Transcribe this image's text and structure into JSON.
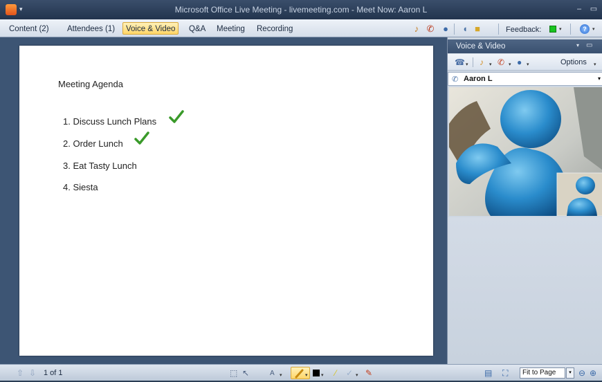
{
  "window": {
    "title": "Microsoft Office Live Meeting - livemeeting.com - Meet Now: Aaron L",
    "minimize_glyph": "–",
    "maximize_glyph": "▭"
  },
  "menu": {
    "items": [
      {
        "label": "Content (2)"
      },
      {
        "label": "Attendees (1)"
      },
      {
        "label": "Voice & Video",
        "active": true
      },
      {
        "label": "Q&A"
      },
      {
        "label": "Meeting"
      },
      {
        "label": "Recording"
      }
    ],
    "feedback_label": "Feedback:",
    "feedback_color": "#19c421"
  },
  "slide": {
    "title": "Meeting Agenda",
    "items": [
      {
        "text": "1. Discuss Lunch Plans",
        "checked": true
      },
      {
        "text": "2. Order Lunch",
        "checked": true
      },
      {
        "text": "3. Eat Tasty Lunch",
        "checked": false
      },
      {
        "text": "4. Siesta",
        "checked": false
      }
    ],
    "check_color": "#3a9a2a"
  },
  "panel": {
    "title": "Voice & Video",
    "options_label": "Options",
    "speaker_name": "Aaron L"
  },
  "status": {
    "page_label": "1 of 1",
    "fit_option": "Fit to Page"
  }
}
